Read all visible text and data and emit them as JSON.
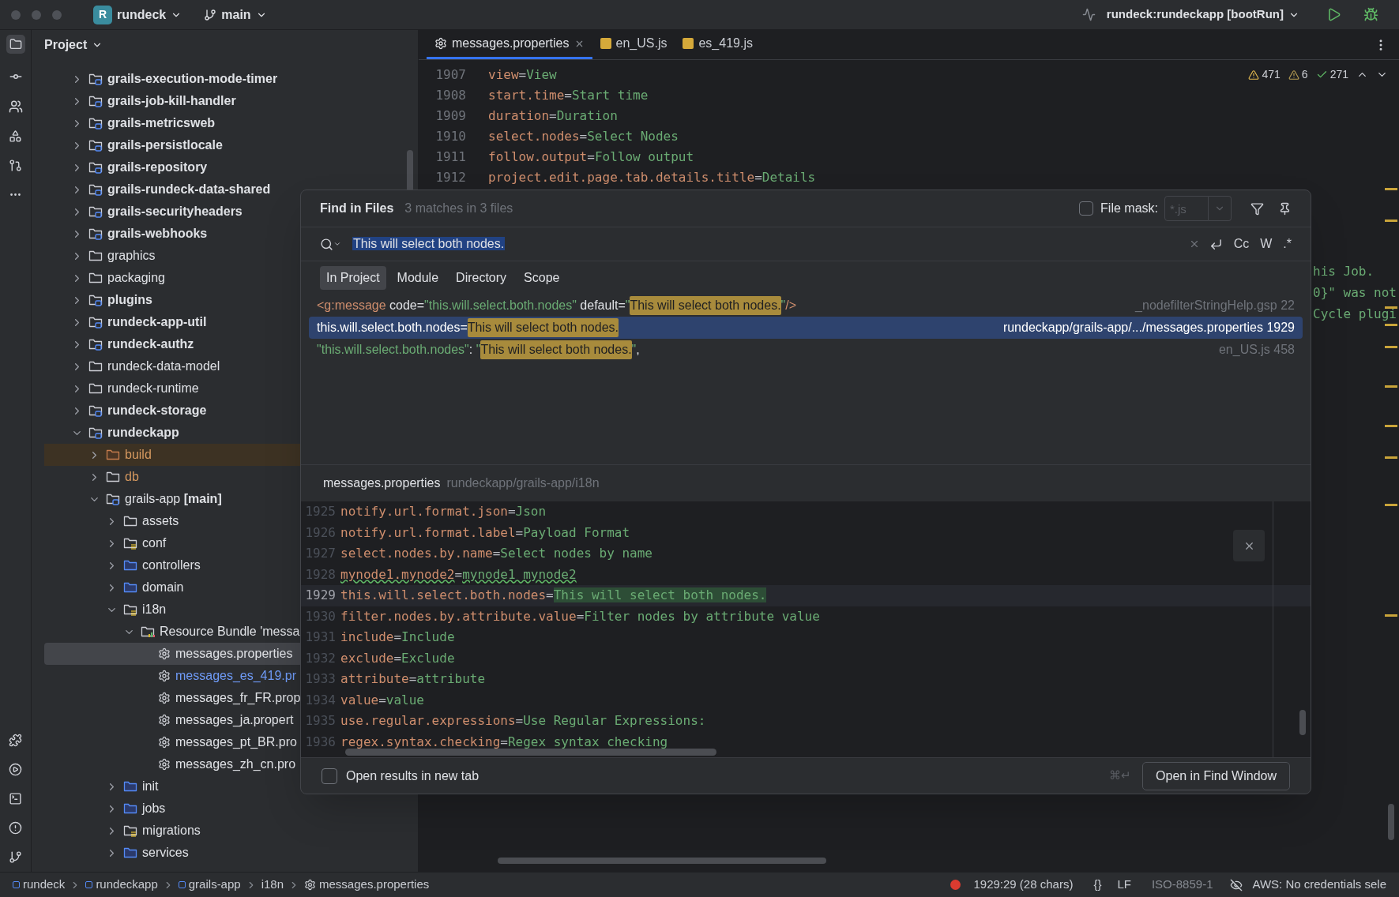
{
  "title_bar": {
    "project_initial": "R",
    "project": "rundeck",
    "branch": "main",
    "run_config": "rundeck:rundeckapp [bootRun]"
  },
  "tool_window": {
    "title": "Project"
  },
  "tree": [
    {
      "label": "grails-execution-mode-timer",
      "kind": "module",
      "expanded": false,
      "selected": false
    },
    {
      "label": "grails-job-kill-handler",
      "kind": "module",
      "expanded": false,
      "selected": false
    },
    {
      "label": "grails-metricsweb",
      "kind": "module",
      "expanded": false,
      "selected": false
    },
    {
      "label": "grails-persistlocale",
      "kind": "module",
      "expanded": false,
      "selected": false
    },
    {
      "label": "grails-repository",
      "kind": "module",
      "expanded": false,
      "selected": false
    },
    {
      "label": "grails-rundeck-data-shared",
      "kind": "module",
      "expanded": false,
      "selected": false
    },
    {
      "label": "grails-securityheaders",
      "kind": "module",
      "expanded": false,
      "selected": false
    },
    {
      "label": "grails-webhooks",
      "kind": "module",
      "expanded": false,
      "selected": false
    },
    {
      "label": "graphics",
      "kind": "folder",
      "expanded": false,
      "selected": false
    },
    {
      "label": "packaging",
      "kind": "folder",
      "expanded": false,
      "selected": false
    },
    {
      "label": "plugins",
      "kind": "module",
      "expanded": false,
      "selected": false
    },
    {
      "label": "rundeck-app-util",
      "kind": "module",
      "expanded": false,
      "selected": false
    },
    {
      "label": "rundeck-authz",
      "kind": "module",
      "expanded": false,
      "selected": false
    },
    {
      "label": "rundeck-data-model",
      "kind": "folder",
      "expanded": false,
      "selected": false
    },
    {
      "label": "rundeck-runtime",
      "kind": "folder",
      "expanded": false,
      "selected": false
    },
    {
      "label": "rundeck-storage",
      "kind": "module",
      "expanded": false,
      "selected": false
    },
    {
      "label": "rundeckapp",
      "kind": "module",
      "expanded": true,
      "selected": false,
      "children": [
        {
          "label": "build",
          "kind": "excluded",
          "expanded": false,
          "selected": false,
          "color": "#d5985f"
        },
        {
          "label": "db",
          "kind": "folder",
          "expanded": false,
          "selected": false,
          "color": "#d5985f"
        },
        {
          "label": "grails-app **[main]**",
          "kind": "source_module",
          "expanded": true,
          "selected": false,
          "children": [
            {
              "label": "assets",
              "kind": "folder",
              "expanded": false,
              "selected": false
            },
            {
              "label": "conf",
              "kind": "resources",
              "expanded": false,
              "selected": false
            },
            {
              "label": "controllers",
              "kind": "sources",
              "expanded": false,
              "selected": false
            },
            {
              "label": "domain",
              "kind": "sources",
              "expanded": false,
              "selected": false
            },
            {
              "label": "i18n",
              "kind": "resources",
              "expanded": true,
              "selected": false,
              "children": [
                {
                  "label": "Resource Bundle 'messa",
                  "kind": "bundle",
                  "expanded": true,
                  "selected": false,
                  "children": [
                    {
                      "label": "messages.properties",
                      "kind": "properties",
                      "selected": true
                    },
                    {
                      "label": "messages_es_419.pr",
                      "kind": "properties",
                      "selected": false,
                      "color": "#6f9bf7"
                    },
                    {
                      "label": "messages_fr_FR.prop",
                      "kind": "properties",
                      "selected": false
                    },
                    {
                      "label": "messages_ja.propert",
                      "kind": "properties",
                      "selected": false
                    },
                    {
                      "label": "messages_pt_BR.pro",
                      "kind": "properties",
                      "selected": false
                    },
                    {
                      "label": "messages_zh_cn.pro",
                      "kind": "properties",
                      "selected": false
                    }
                  ]
                }
              ]
            },
            {
              "label": "init",
              "kind": "sources",
              "expanded": false,
              "selected": false
            },
            {
              "label": "jobs",
              "kind": "sources",
              "expanded": false,
              "selected": false
            },
            {
              "label": "migrations",
              "kind": "resources",
              "expanded": false,
              "selected": false
            },
            {
              "label": "services",
              "kind": "sources",
              "expanded": false,
              "selected": false
            }
          ]
        }
      ]
    }
  ],
  "editor": {
    "tabs": [
      {
        "label": "messages.properties",
        "kind": "properties",
        "selected": true
      },
      {
        "label": "en_US.js",
        "kind": "js",
        "selected": false
      },
      {
        "label": "es_419.js",
        "kind": "js",
        "selected": false
      }
    ],
    "inspections": {
      "warnings": "471",
      "weak_warnings": "6",
      "typos": "271"
    },
    "lines": [
      {
        "number": "1907",
        "key": "view",
        "sep": "=",
        "value": "View"
      },
      {
        "number": "1908",
        "key": "start.time",
        "sep": "=",
        "value": "Start time"
      },
      {
        "number": "1909",
        "key": "duration",
        "sep": "=",
        "value": "Duration"
      },
      {
        "number": "1910",
        "key": "select.nodes",
        "sep": "=",
        "value": "Select Nodes"
      },
      {
        "number": "1911",
        "key": "follow.output",
        "sep": "=",
        "value": "Follow output"
      },
      {
        "number": "1912",
        "key": "project.edit.page.tab.details.title",
        "sep": "=",
        "value": "Details"
      }
    ],
    "fragments": [
      "his Job.",
      "0}\" was not",
      "Cycle plugi"
    ]
  },
  "find_dialog": {
    "title": "Find in Files",
    "summary": "3 matches in 3 files",
    "file_mask": {
      "label": "File mask:",
      "checked": false,
      "placeholder": "*.js"
    },
    "query": "This will select both nodes.",
    "options": [
      "Cc",
      "W",
      ".*"
    ],
    "scopes": [
      {
        "label": "In Project",
        "selected": true
      },
      {
        "label": "Module",
        "selected": false
      },
      {
        "label": "Directory",
        "selected": false
      },
      {
        "label": "Scope",
        "selected": false
      }
    ],
    "results": [
      {
        "selected": false,
        "location": "_nodefilterStringHelp.gsp 22",
        "parts": [
          {
            "kind": "tag",
            "text": "<g:message"
          },
          {
            "kind": "plain",
            "text": " code="
          },
          {
            "kind": "string",
            "text": "\"this.will.select.both.nodes\""
          },
          {
            "kind": "plain",
            "text": " default="
          },
          {
            "kind": "string",
            "text": "\""
          },
          {
            "kind": "match",
            "text": "This will select both nodes."
          },
          {
            "kind": "string",
            "text": "\""
          },
          {
            "kind": "tag",
            "text": "/>"
          }
        ]
      },
      {
        "selected": true,
        "location": "rundeckapp/grails-app/.../messages.properties 1929",
        "parts": [
          {
            "kind": "plain",
            "text": "this.will.select.both.nodes="
          },
          {
            "kind": "match",
            "text": "This will select both nodes."
          }
        ]
      },
      {
        "selected": false,
        "location": "en_US.js 458",
        "parts": [
          {
            "kind": "string",
            "text": "\"this.will.select.both.nodes\""
          },
          {
            "kind": "plain",
            "text": ": "
          },
          {
            "kind": "string",
            "text": "\""
          },
          {
            "kind": "match",
            "text": "This will select both nodes."
          },
          {
            "kind": "string",
            "text": "\""
          },
          {
            "kind": "plain",
            "text": ","
          }
        ]
      }
    ],
    "preview": {
      "file": "messages.properties",
      "path": "rundeckapp/grails-app/i18n",
      "lines": [
        {
          "number": "1925",
          "key": "notify.url.format.json",
          "sep": "=",
          "value": "Json",
          "current": false,
          "typo": false
        },
        {
          "number": "1926",
          "key": "notify.url.format.label",
          "sep": "=",
          "value": "Payload Format",
          "current": false,
          "typo": false
        },
        {
          "number": "1927",
          "key": "select.nodes.by.name",
          "sep": "=",
          "value": "Select nodes by name",
          "current": false,
          "typo": false
        },
        {
          "number": "1928",
          "key": "mynode1.mynode2",
          "sep": "=",
          "value": "mynode1 mynode2",
          "current": false,
          "typo": true
        },
        {
          "number": "1929",
          "key": "this.will.select.both.nodes",
          "sep": "=",
          "value": "This will select both nodes.",
          "current": true,
          "typo": false
        },
        {
          "number": "1930",
          "key": "filter.nodes.by.attribute.value",
          "sep": "=",
          "value": "Filter nodes by attribute value",
          "current": false,
          "typo": false
        },
        {
          "number": "1931",
          "key": "include",
          "sep": "=",
          "value": "Include",
          "current": false,
          "typo": false
        },
        {
          "number": "1932",
          "key": "exclude",
          "sep": "=",
          "value": "Exclude",
          "current": false,
          "typo": false
        },
        {
          "number": "1933",
          "key": "attribute",
          "sep": "=",
          "value": "attribute",
          "current": false,
          "typo": false
        },
        {
          "number": "1934",
          "key": "value",
          "sep": "=",
          "value": "value",
          "current": false,
          "typo": false
        },
        {
          "number": "1935",
          "key": "use.regular.expressions",
          "sep": "=",
          "value": "Use Regular Expressions:",
          "current": false,
          "typo": false
        },
        {
          "number": "1936",
          "key": "regex.syntax.checking",
          "sep": "=",
          "value": "Regex syntax checking",
          "current": false,
          "typo": false
        }
      ]
    },
    "new_tab": {
      "label": "Open results in new tab",
      "checked": false
    },
    "shortcut": "⌘↵",
    "open_button": "Open in Find Window"
  },
  "status_bar": {
    "breadcrumbs": [
      {
        "label": "rundeck",
        "kind": "module"
      },
      {
        "label": "rundeckapp",
        "kind": "module"
      },
      {
        "label": "grails-app",
        "kind": "module"
      },
      {
        "label": "i18n",
        "kind": "folder"
      },
      {
        "label": "messages.properties",
        "kind": "properties"
      }
    ],
    "position": "1929:29 (28 chars)",
    "braces": "{}",
    "line_ending": "LF",
    "encoding": "ISO-8859-1",
    "aws": "AWS: No credentials sele"
  }
}
